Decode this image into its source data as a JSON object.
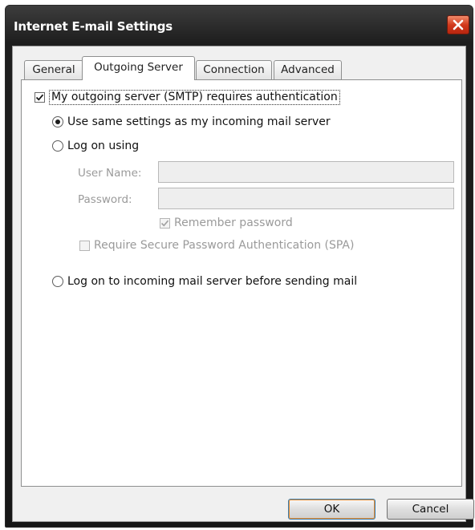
{
  "window": {
    "title": "Internet E-mail Settings"
  },
  "tabs": [
    {
      "label": "General",
      "active": false
    },
    {
      "label": "Outgoing Server",
      "active": true
    },
    {
      "label": "Connection",
      "active": false
    },
    {
      "label": "Advanced",
      "active": false
    }
  ],
  "outgoing": {
    "smtp_auth": {
      "label": "My outgoing server (SMTP) requires authentication",
      "checked": true
    },
    "options": [
      {
        "label": "Use same settings as my incoming mail server",
        "selected": true
      },
      {
        "label": "Log on using",
        "selected": false
      }
    ],
    "username": {
      "label": "User Name:",
      "value": ""
    },
    "password": {
      "label": "Password:",
      "value": ""
    },
    "remember_password": {
      "label": "Remember password",
      "checked": true,
      "enabled": false
    },
    "spa": {
      "label": "Require Secure Password Authentication (SPA)",
      "checked": false,
      "enabled": false
    },
    "logon_before_send": {
      "label": "Log on to incoming mail server before sending mail",
      "selected": false
    }
  },
  "buttons": {
    "ok": "OK",
    "cancel": "Cancel"
  },
  "icons": {
    "close": "close-icon",
    "check": "checkmark-icon"
  },
  "colors": {
    "title_bar": "#1e1e1e",
    "close_button": "#d2391c",
    "default_button_border": "#3c7fb1"
  }
}
